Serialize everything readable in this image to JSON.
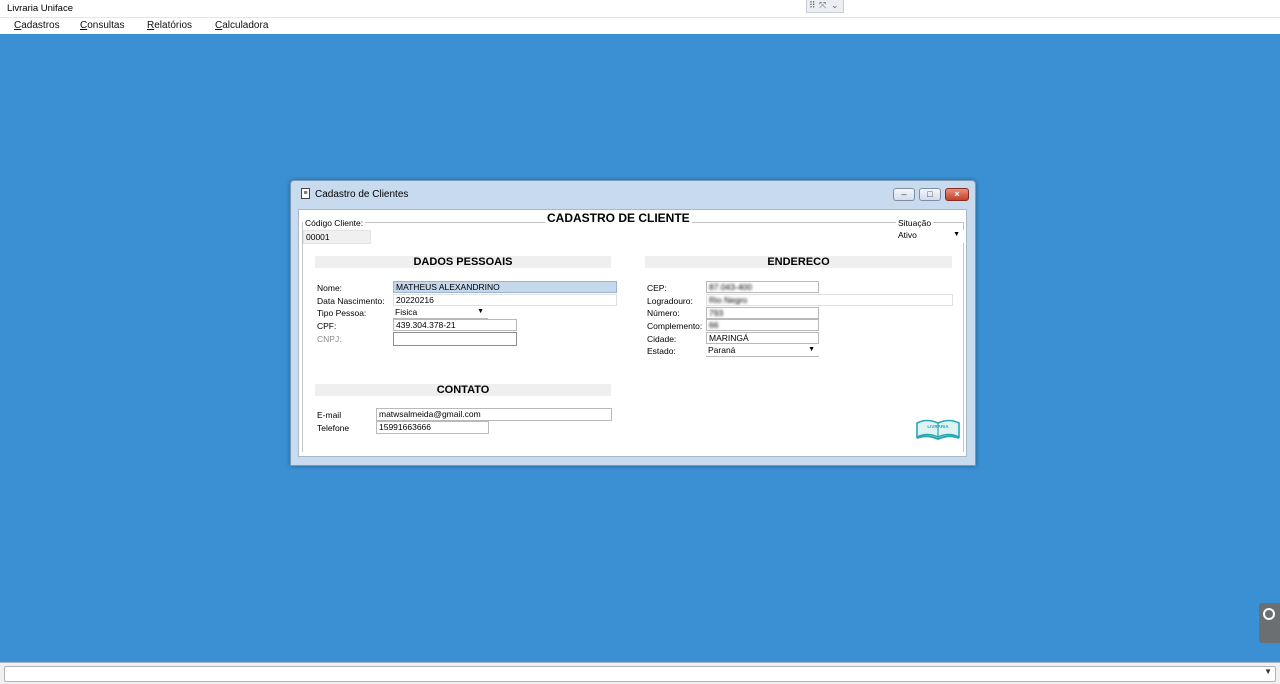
{
  "app": {
    "title": "Livraria Uniface"
  },
  "menu": [
    {
      "accel": "C",
      "rest": "adastros"
    },
    {
      "accel": "C",
      "rest": "onsultas"
    },
    {
      "accel": "R",
      "rest": "elatórios"
    },
    {
      "accel": "C",
      "rest": "alculadora"
    }
  ],
  "window": {
    "title": "Cadastro de Clientes"
  },
  "form": {
    "title": "CADASTRO DE CLIENTE",
    "codigo_label": "Código Cliente:",
    "codigo_value": "00001",
    "situacao_label": "Situação",
    "situacao_value": "Ativo"
  },
  "dados_pessoais": {
    "heading": "DADOS PESSOAIS",
    "nome_label": "Nome:",
    "nome_value": "MATHEUS ALEXANDRINO",
    "nasc_label": "Data Nascimento:",
    "nasc_value": "20220216",
    "tipo_label": "Tipo Pessoa:",
    "tipo_value": "Fisica",
    "cpf_label": "CPF:",
    "cpf_value": "439.304.378-21",
    "cnpj_label": "CNPJ:",
    "cnpj_value": ""
  },
  "contato": {
    "heading": "CONTATO",
    "email_label": "E-mail",
    "email_value": "matwsalmeida@gmail.com",
    "telefone_label": "Telefone",
    "telefone_value": "15991663666"
  },
  "endereco": {
    "heading": "ENDERECO",
    "cep_label": "CEP:",
    "cep_value": "87.043-400",
    "logradouro_label": "Logradouro:",
    "logradouro_value": "Rio Negro",
    "numero_label": "Número:",
    "numero_value": "793",
    "complemento_label": "Complemento:",
    "complemento_value": "66",
    "cidade_label": "Cidade:",
    "cidade_value": "MARINGÁ",
    "estado_label": "Estado:",
    "estado_value": "Paraná"
  },
  "logo_text": "LIVRARIA",
  "colors": {
    "desktop": "#3a90d3",
    "selected_field": "#c5d7ea",
    "close_button": "#c3412a"
  }
}
